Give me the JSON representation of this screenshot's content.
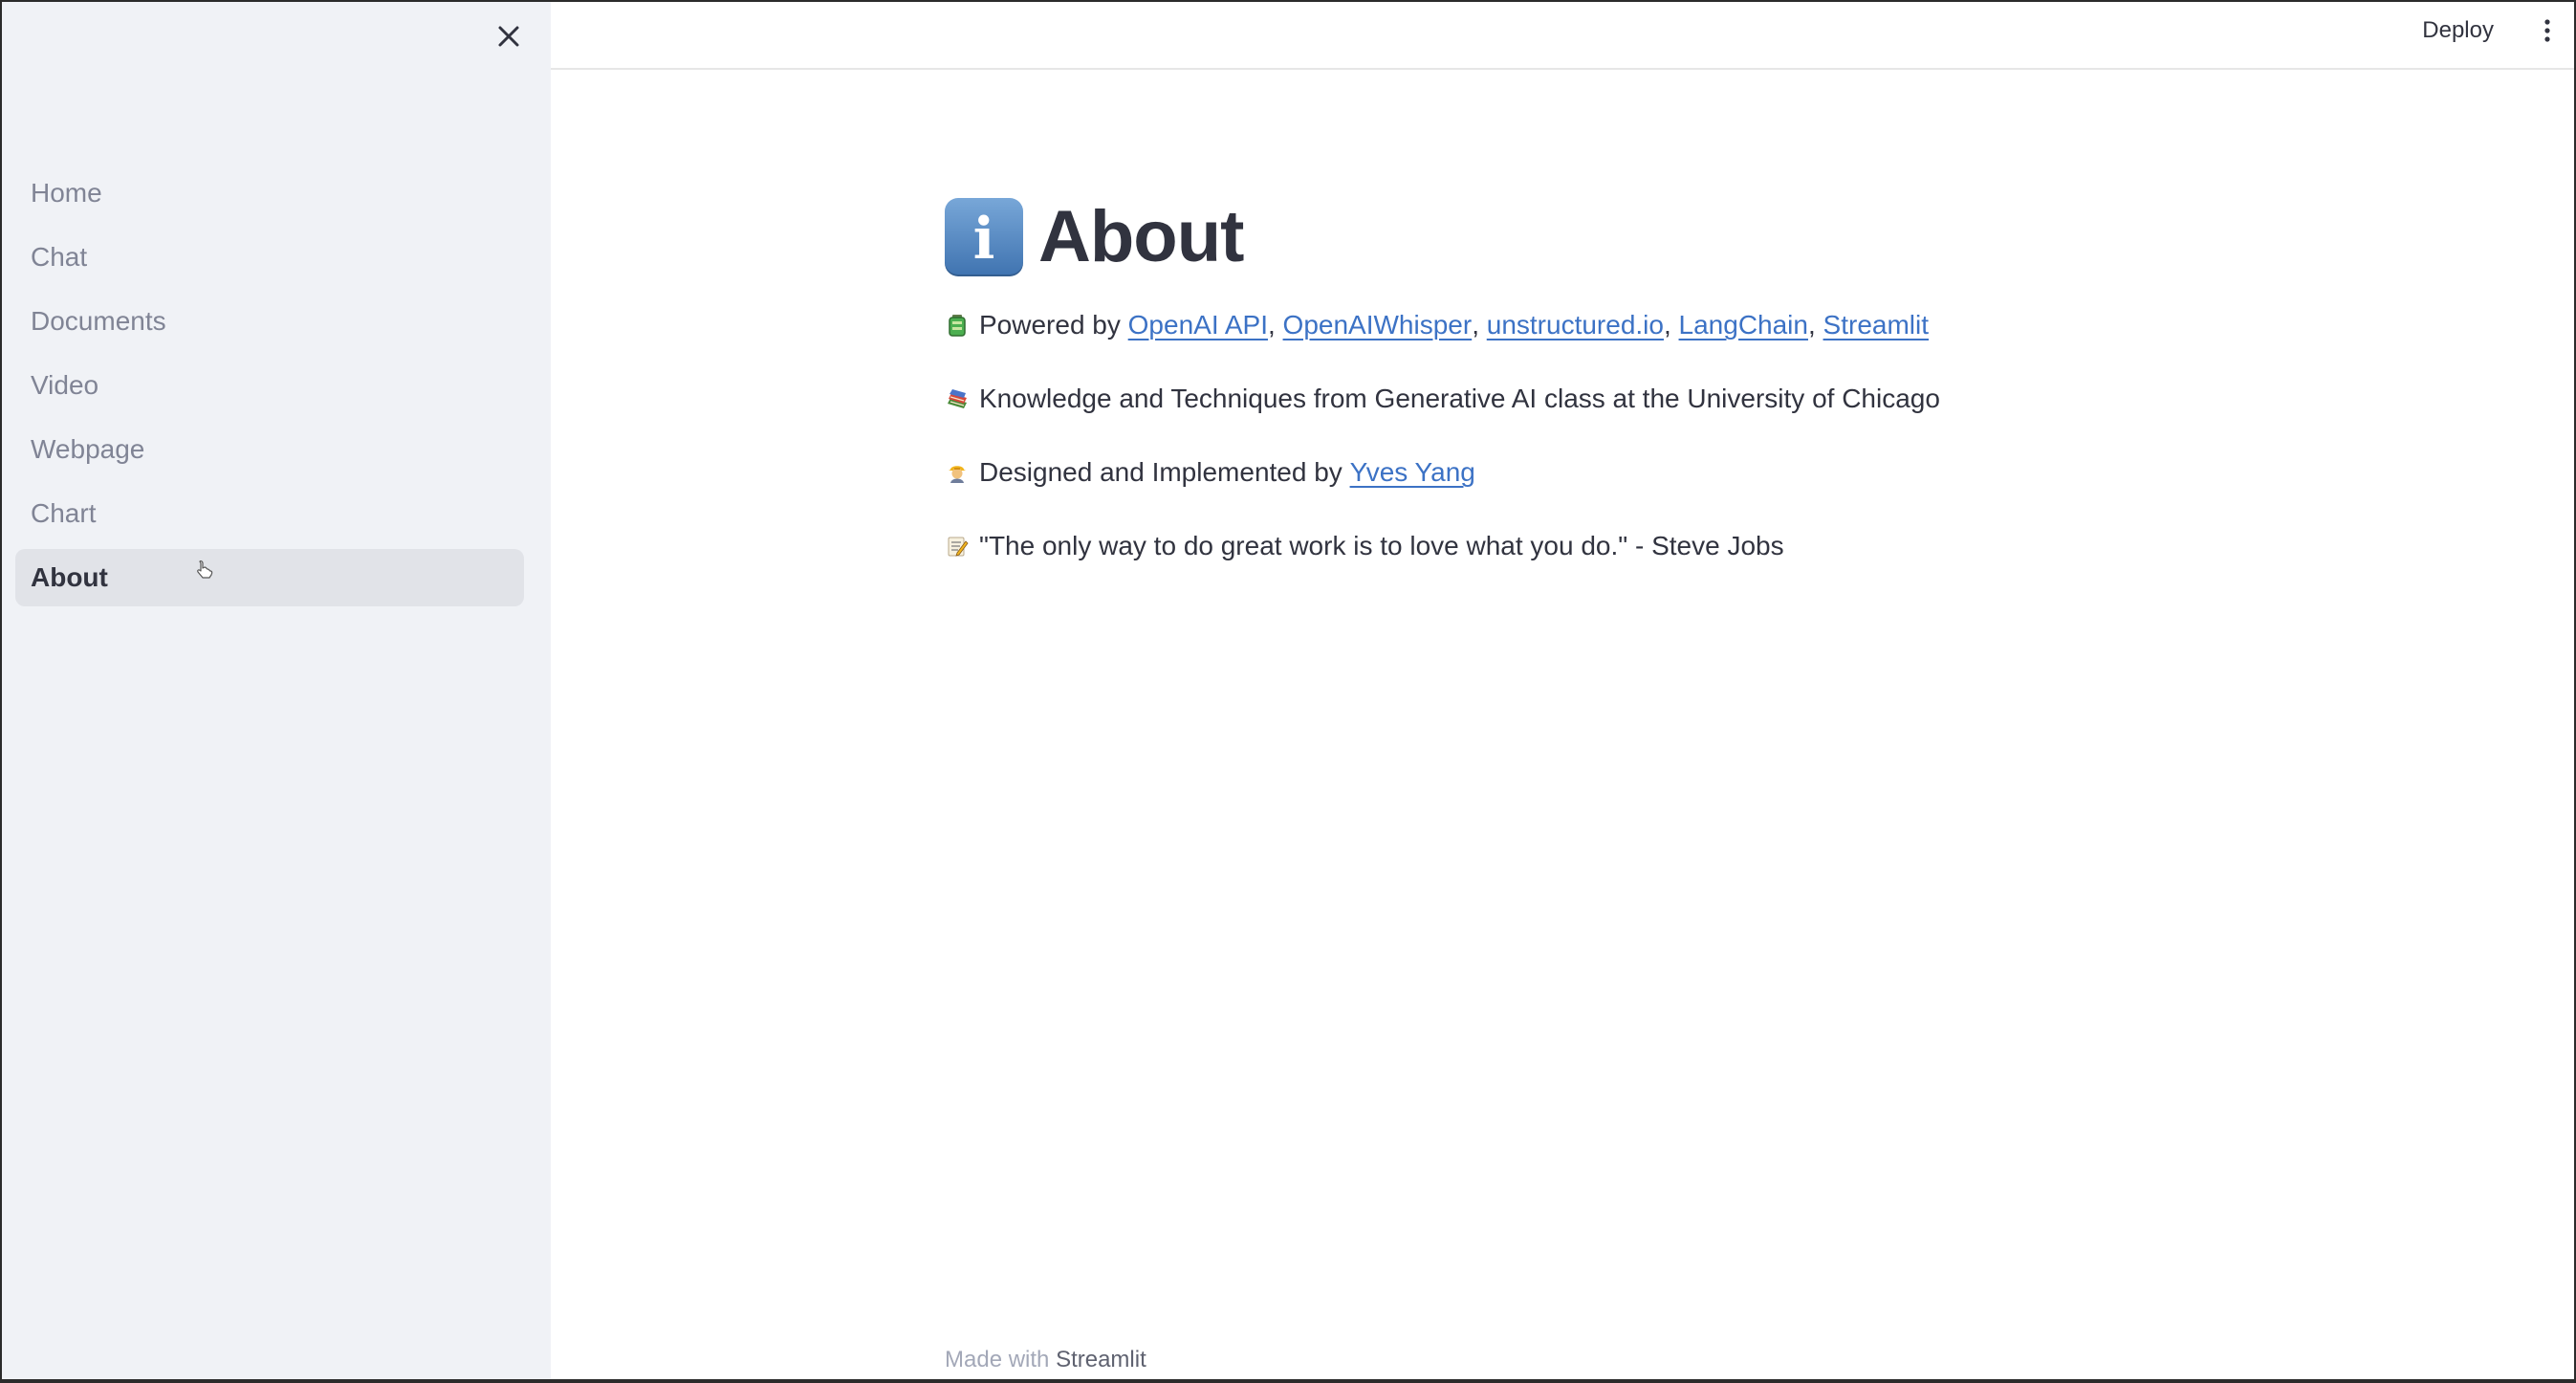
{
  "sidebar": {
    "close_icon": "close-icon",
    "items": [
      {
        "label": "Home",
        "active": false
      },
      {
        "label": "Chat",
        "active": false
      },
      {
        "label": "Documents",
        "active": false
      },
      {
        "label": "Video",
        "active": false
      },
      {
        "label": "Webpage",
        "active": false
      },
      {
        "label": "Chart",
        "active": false
      },
      {
        "label": "About",
        "active": true
      }
    ]
  },
  "header": {
    "deploy_label": "Deploy",
    "menu_icon": "more-vertical-icon"
  },
  "page": {
    "title": "About",
    "title_icon": "information-icon",
    "powered": {
      "icon": "battery-icon",
      "prefix": "Powered by",
      "links": [
        "OpenAI API",
        "OpenAIWhisper",
        "unstructured.io",
        "LangChain",
        "Streamlit"
      ]
    },
    "knowledge": {
      "icon": "books-icon",
      "text": "Knowledge and Techniques from Generative AI class at the University of Chicago"
    },
    "designed": {
      "icon": "builder-icon",
      "prefix": "Designed and Implemented by",
      "link": "Yves Yang"
    },
    "quote": {
      "icon": "memo-icon",
      "text": "\"The only way to do great work is to love what you do.\" - Steve Jobs"
    }
  },
  "footer": {
    "prefix": "Made with",
    "brand": "Streamlit"
  },
  "colors": {
    "sidebar_background": "#f0f2f6",
    "active_item_background": "#e1e3e8",
    "text": "#31333f",
    "muted_text": "#808495",
    "link": "#3c72c5"
  }
}
